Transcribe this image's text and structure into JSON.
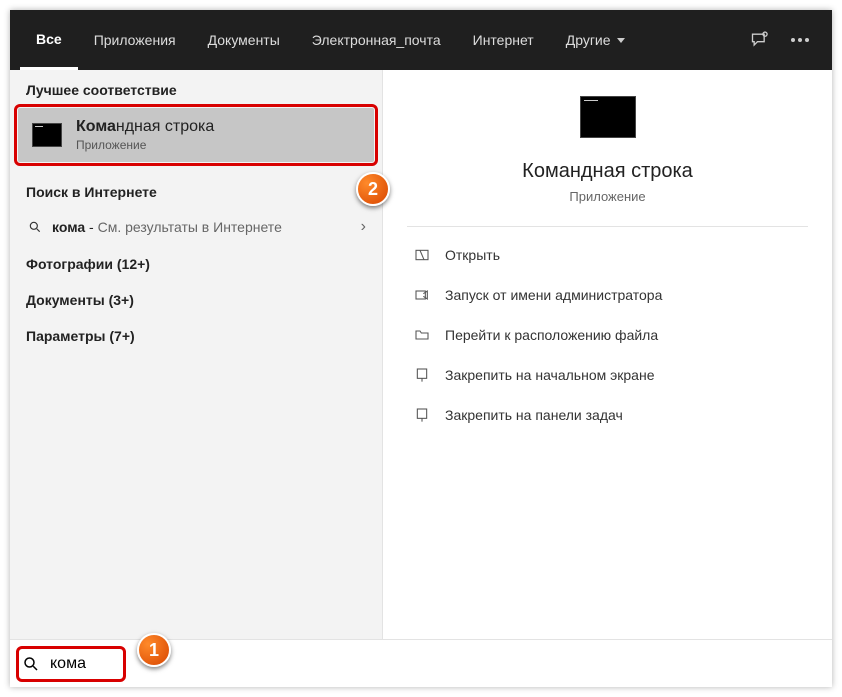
{
  "tabs": {
    "all": "Все",
    "apps": "Приложения",
    "docs": "Документы",
    "email": "Электронная_почта",
    "internet": "Интернет",
    "other": "Другие"
  },
  "left": {
    "best_header": "Лучшее соответствие",
    "best_bold": "Кома",
    "best_rest": "ндная строка",
    "best_sub": "Приложение",
    "web_header": "Поиск в Интернете",
    "web_query_bold": "кома",
    "web_query_rest": " - ",
    "web_query_sub": "См. результаты в Интернете",
    "cat_photos": "Фотографии (12+)",
    "cat_docs": "Документы (3+)",
    "cat_params": "Параметры (7+)"
  },
  "preview": {
    "title": "Командная строка",
    "sub": "Приложение",
    "actions": {
      "open": "Открыть",
      "admin": "Запуск от имени администратора",
      "location": "Перейти к расположению файла",
      "pin_start": "Закрепить на начальном экране",
      "pin_task": "Закрепить на панели задач"
    }
  },
  "search": {
    "value": "кома"
  },
  "callouts": {
    "one": "1",
    "two": "2"
  }
}
